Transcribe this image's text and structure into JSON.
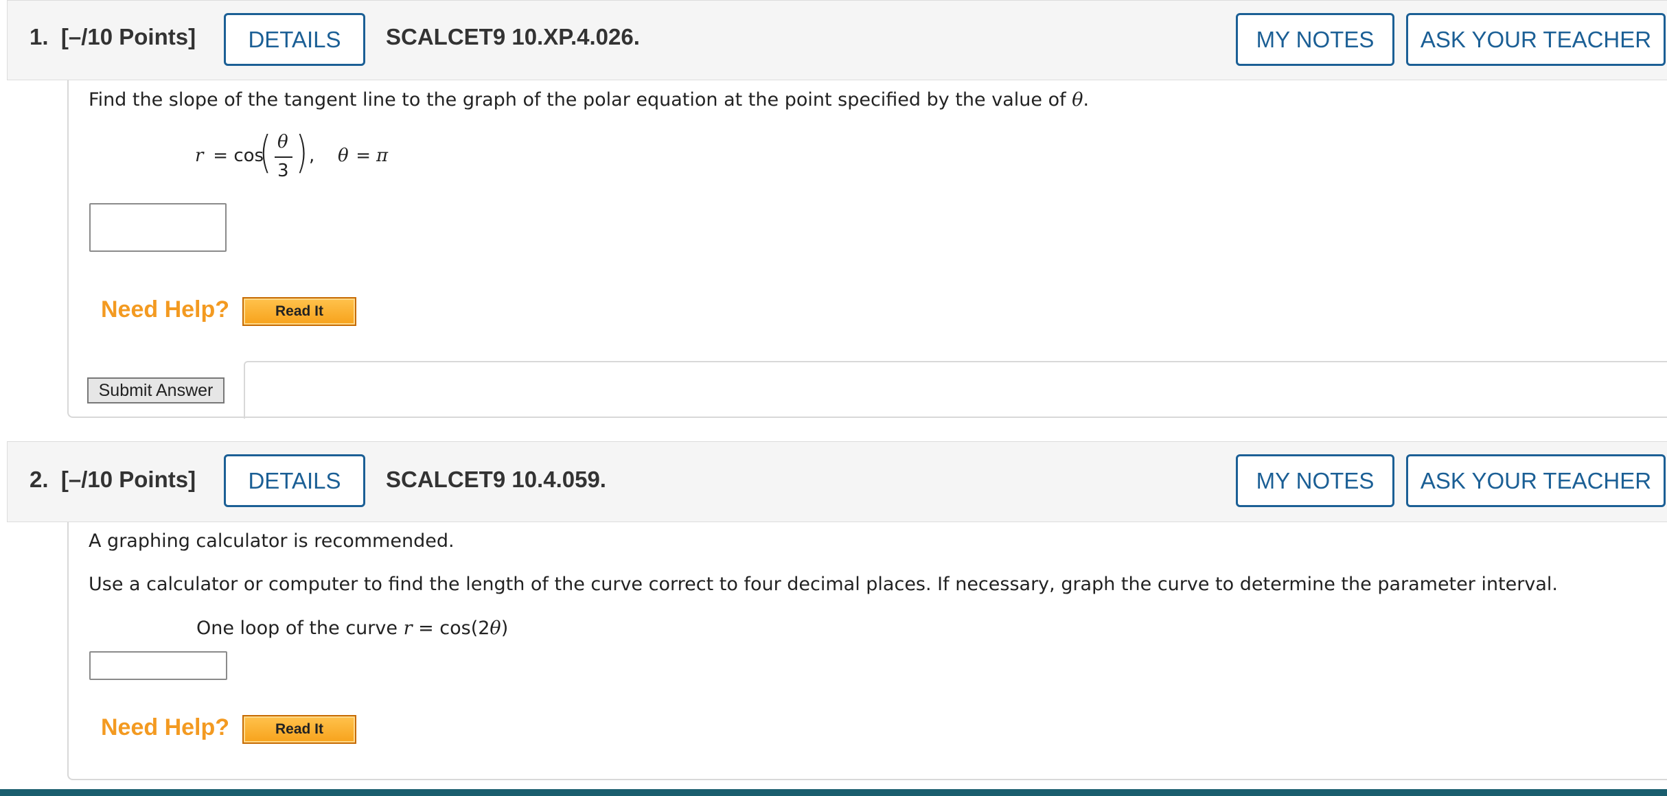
{
  "questions": [
    {
      "number": "1.",
      "points": "[–/10 Points]",
      "details_label": "DETAILS",
      "code": "SCALCET9 10.XP.4.026.",
      "my_notes_label": "MY NOTES",
      "ask_teacher_label": "ASK YOUR TEACHER",
      "prompt_before": "Find the slope of the tangent line to the graph of the polar equation at the point specified by the value of ",
      "prompt_var": "θ",
      "prompt_after": ".",
      "eq": {
        "r": "r",
        "equals": " = cos",
        "numerator": "θ",
        "denominator": "3",
        "comma": ",",
        "theta": "θ",
        "equals2": " = ",
        "pi": "π"
      },
      "answer_value": "",
      "need_help": "Need Help?",
      "read_it": "Read It",
      "submit_label": "Submit Answer"
    },
    {
      "number": "2.",
      "points": "[–/10 Points]",
      "details_label": "DETAILS",
      "code": "SCALCET9 10.4.059.",
      "my_notes_label": "MY NOTES",
      "ask_teacher_label": "ASK YOUR TEACHER",
      "line1": "A graphing calculator is recommended.",
      "line2": "Use a calculator or computer to find the length of the curve correct to four decimal places. If necessary, graph the curve to determine the parameter interval.",
      "line3_before": "One loop of the curve ",
      "line3_r": "r",
      "line3_mid": " = cos(2",
      "line3_theta": "θ",
      "line3_after": ")",
      "answer_value": "",
      "need_help": "Need Help?",
      "read_it": "Read It"
    }
  ],
  "colors": {
    "accent": "#1b5f95",
    "need_help": "#f39a21",
    "footer": "#1a5e6e"
  }
}
